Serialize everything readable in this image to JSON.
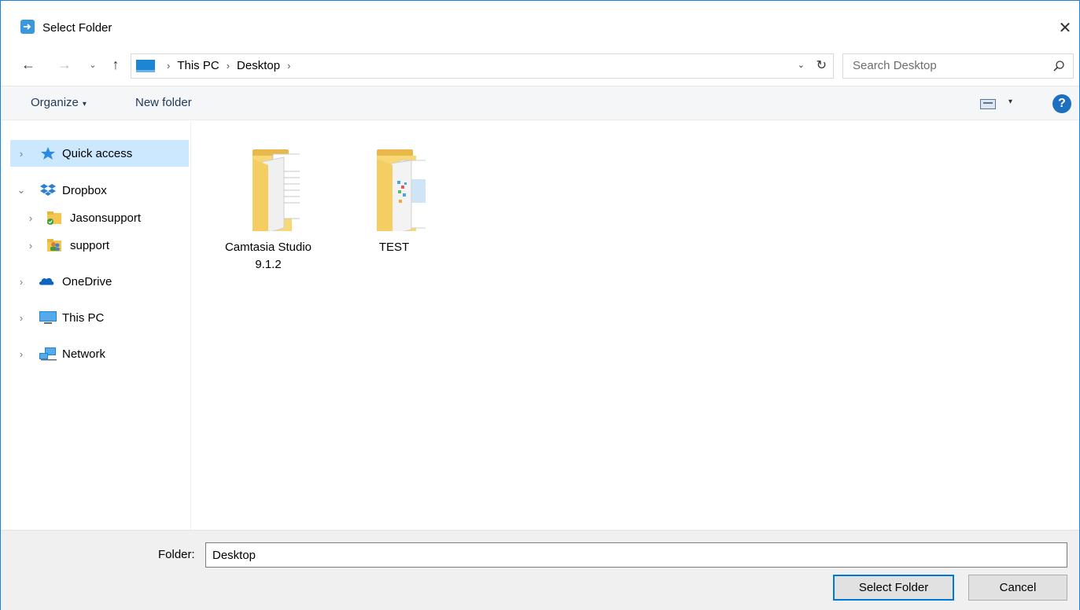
{
  "window": {
    "title": "Select Folder",
    "close_glyph": "✕"
  },
  "nav": {
    "back_glyph": "←",
    "forward_glyph": "→",
    "recent_glyph": "⌄",
    "up_glyph": "↑",
    "breadcrumbs": [
      "This PC",
      "Desktop"
    ],
    "crumb_separator": "›",
    "dropdown_glyph": "⌄",
    "refresh_glyph": "↻"
  },
  "search": {
    "placeholder": "Search Desktop"
  },
  "toolbar": {
    "organize_label": "Organize",
    "organize_caret": "▾",
    "new_folder_label": "New folder",
    "view_caret": "▾",
    "help_glyph": "?"
  },
  "sidebar": {
    "items": [
      {
        "label": "Quick access",
        "icon": "star-icon",
        "selected": true
      },
      {
        "label": "Dropbox",
        "icon": "dropbox-icon",
        "expanded": true
      },
      {
        "label": "Jasonsupport",
        "icon": "folder-sync-icon"
      },
      {
        "label": "support",
        "icon": "shared-folder-icon"
      },
      {
        "label": "OneDrive",
        "icon": "onedrive-icon"
      },
      {
        "label": "This PC",
        "icon": "computer-icon"
      },
      {
        "label": "Network",
        "icon": "network-icon"
      }
    ],
    "chevron_collapsed": "›",
    "chevron_expanded": "⌄"
  },
  "content": {
    "folders": [
      {
        "name_line1": "Camtasia Studio",
        "name_line2": "9.1.2"
      },
      {
        "name_line1": "TEST",
        "name_line2": ""
      }
    ]
  },
  "footer": {
    "folder_label": "Folder:",
    "folder_value": "Desktop",
    "select_button": "Select Folder",
    "cancel_button": "Cancel"
  },
  "colors": {
    "accent": "#0078d7",
    "selection": "#cce8ff",
    "folder_yellow": "#f8d775"
  }
}
